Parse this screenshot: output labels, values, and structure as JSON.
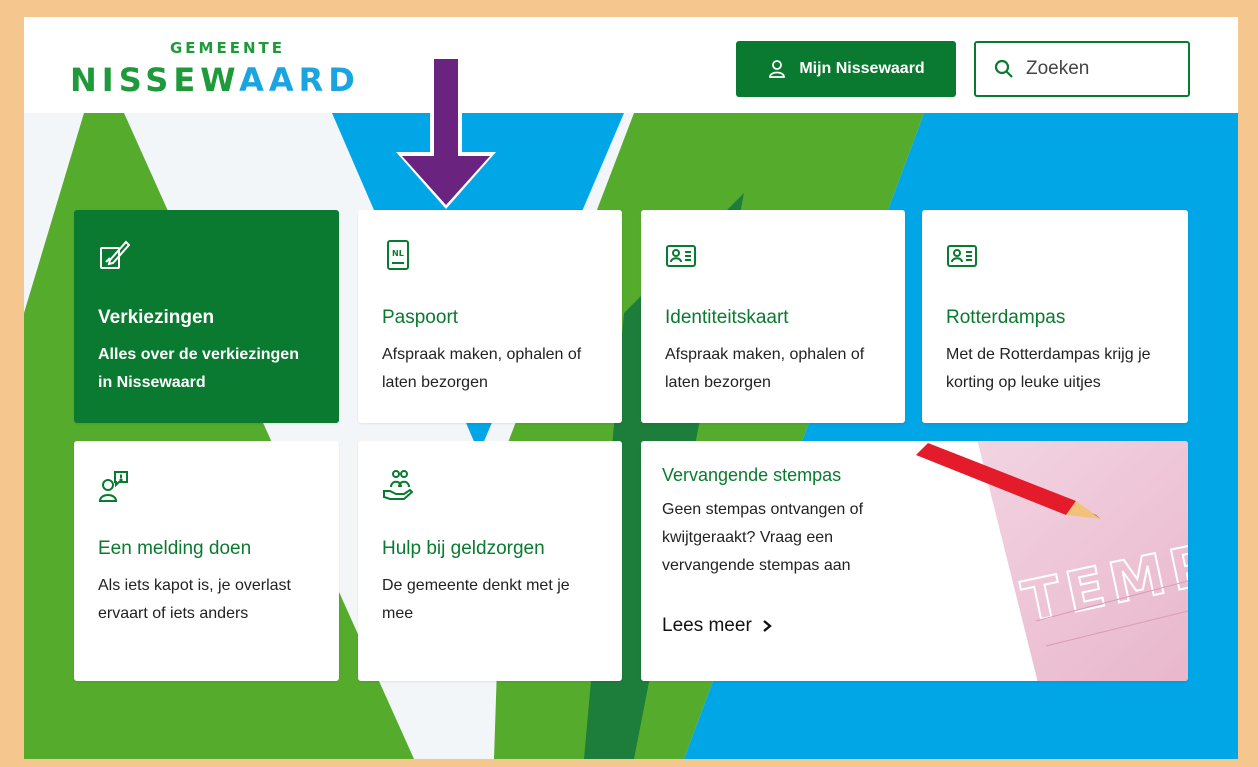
{
  "colors": {
    "brand_green": "#0a7a30",
    "light_green": "#55ab2b",
    "blue": "#00a6e6",
    "frame": "#f5c78f",
    "arrow": "#6b2380"
  },
  "logo": {
    "top": "GEMEENTE",
    "main_a": "NISSEW",
    "main_b": "AARD"
  },
  "header": {
    "account_label": "Mijn Nissewaard",
    "account_icon": "user-icon",
    "search_placeholder": "Zoeken",
    "search_icon": "search-icon"
  },
  "cards": [
    {
      "title": "Verkiezingen",
      "desc": "Alles over de verkiezingen in Nissewaard",
      "icon": "ballot-pencil-icon"
    },
    {
      "title": "Paspoort",
      "desc": "Afspraak maken, ophalen of laten bezorgen",
      "icon": "passport-icon"
    },
    {
      "title": "Identiteitskaart",
      "desc": "Afspraak maken, ophalen of laten bezorgen",
      "icon": "id-card-icon"
    },
    {
      "title": "Rotterdampas",
      "desc": "Met de Rotterdampas krijg je korting op leuke uitjes",
      "icon": "id-card-icon"
    },
    {
      "title": "Een melding doen",
      "desc": "Als iets kapot is, je overlast ervaart of iets anders",
      "icon": "report-person-icon"
    },
    {
      "title": "Hulp bij geldzorgen",
      "desc": "De gemeente denkt met je mee",
      "icon": "helping-hand-icon"
    }
  ],
  "feature": {
    "title": "Vervangende stempas",
    "desc": "Geen stempas ontvangen of kwijtgeraakt? Vraag een vervangende stempas aan",
    "more": "Lees meer",
    "photo_text": "STEMP"
  }
}
